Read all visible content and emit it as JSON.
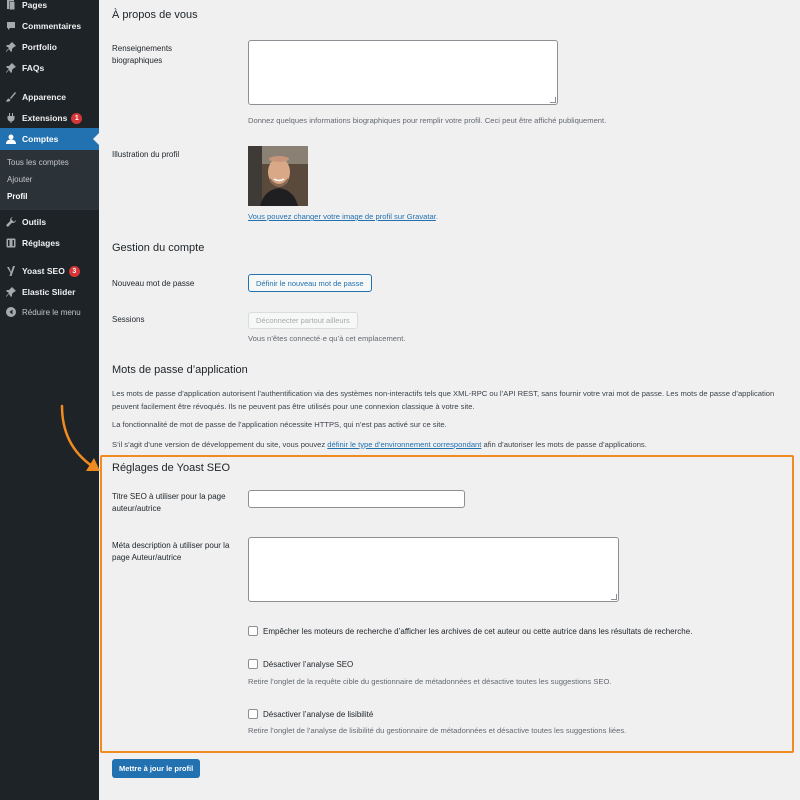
{
  "sidebar": {
    "items": [
      {
        "label": "Pages",
        "icon": "pages-icon"
      },
      {
        "label": "Commentaires",
        "icon": "comments-icon"
      },
      {
        "label": "Portfolio",
        "icon": "pin-icon"
      },
      {
        "label": "FAQs",
        "icon": "pin-icon"
      },
      {
        "label": "Apparence",
        "icon": "brush-icon"
      },
      {
        "label": "Extensions",
        "icon": "plugin-icon",
        "badge": "1"
      },
      {
        "label": "Comptes",
        "icon": "user-icon"
      },
      {
        "label": "Outils",
        "icon": "wrench-icon"
      },
      {
        "label": "Réglages",
        "icon": "settings-icon"
      },
      {
        "label": "Yoast SEO",
        "icon": "yoast-icon",
        "badge": "3"
      },
      {
        "label": "Elastic Slider",
        "icon": "pin-icon"
      },
      {
        "label": "Réduire le menu",
        "icon": "collapse-icon"
      }
    ],
    "submenu": [
      "Tous les comptes",
      "Ajouter",
      "Profil"
    ],
    "active_color": "#2271b1"
  },
  "about": {
    "heading": "À propos de vous",
    "bio_label": "Renseignements biographiques",
    "bio_value": "",
    "bio_desc": "Donnez quelques informations biographiques pour remplir votre profil. Ceci peut être affiché publiquement.",
    "avatar_label": "Illustration du profil",
    "gravatar_link": "Vous pouvez changer votre image de profil sur Gravatar",
    "gravatar_suffix": "."
  },
  "account": {
    "heading": "Gestion du compte",
    "password_label": "Nouveau mot de passe",
    "password_button": "Définir le nouveau mot de passe",
    "sessions_label": "Sessions",
    "sessions_button": "Déconnecter partout ailleurs",
    "sessions_desc": "Vous n’êtes connecté·e qu’à cet emplacement."
  },
  "app_passwords": {
    "heading": "Mots de passe d’application",
    "para1": "Les mots de passe d’application autorisent l’authentification via des systèmes non-interactifs tels que XML-RPC ou l’API REST, sans fournir votre vrai mot de passe. Les mots de passe d’application peuvent facilement être révoqués. Ils ne peuvent pas être utilisés pour une connexion classique à votre site.",
    "para2": "La fonctionnalité de mot de passe de l’application nécessite HTTPS, qui n’est pas activé sur ce site.",
    "para3_prefix": "S’il s’agit d’une version de développement du site, vous pouvez ",
    "para3_link": "définir le type d’environnement correspondant",
    "para3_suffix": " afin d’autoriser les mots de passe d’applications."
  },
  "yoast": {
    "heading": "Réglages de Yoast SEO",
    "title_label": "Titre SEO à utiliser pour la page auteur/autrice",
    "title_value": "",
    "meta_label": "Méta description à utiliser pour la page Auteur/autrice",
    "meta_value": "",
    "noindex_label": "Empêcher les moteurs de recherche d’afficher les archives de cet auteur ou cette autrice dans les résultats de recherche.",
    "seo_label": "Désactiver l’analyse SEO",
    "seo_desc": "Retire l’onglet de la requête cible du gestionnaire de métadonnées et désactive toutes les suggestions SEO.",
    "readability_label": "Désactiver l’analyse de lisibilité",
    "readability_desc": "Retire l’onglet de l’analyse de lisibilité du gestionnaire de métadonnées et désactive toutes les suggestions liées.",
    "highlight_color": "#f28b1f"
  },
  "submit_button": "Mettre à jour le profil"
}
